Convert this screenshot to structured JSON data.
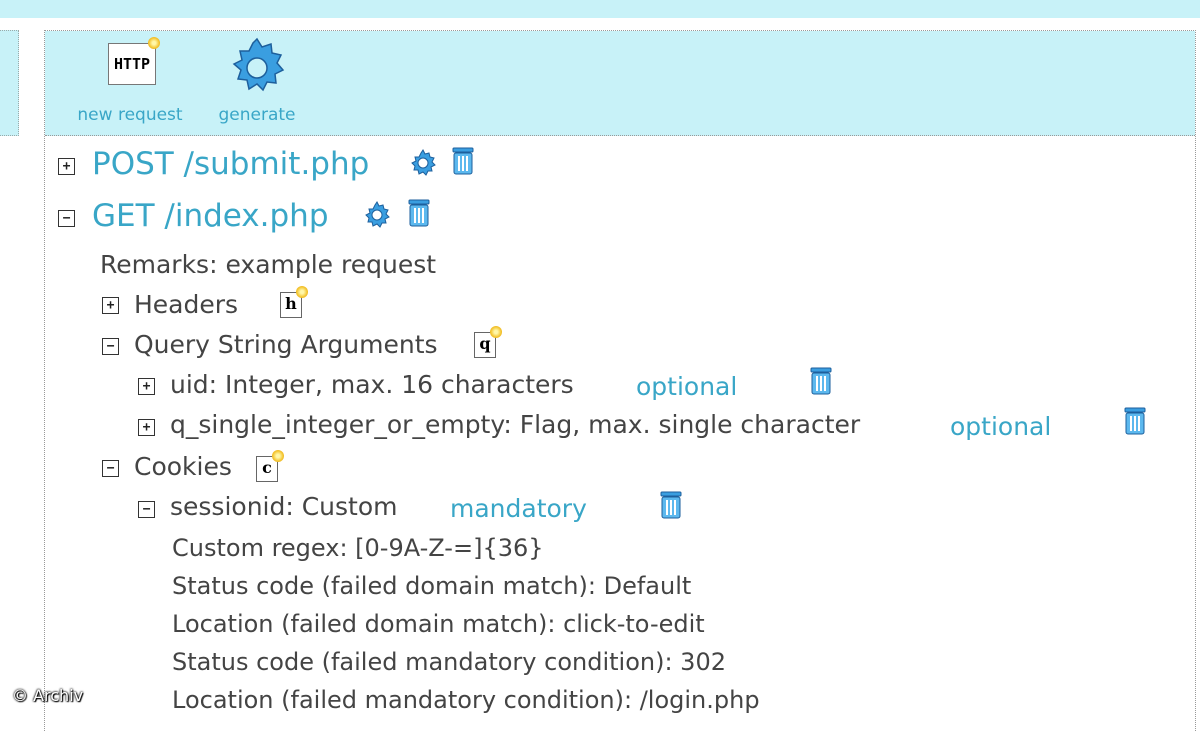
{
  "toolbar": {
    "new_request_label": "new request",
    "generate_label": "generate",
    "http_icon_text": "HTTP"
  },
  "requests": [
    {
      "title": "POST /submit.php",
      "expanded": false
    },
    {
      "title": "GET /index.php",
      "expanded": true
    }
  ],
  "remarks": "Remarks: example request",
  "sections": {
    "headers": {
      "label": "Headers",
      "icon_letter": "h"
    },
    "query": {
      "label": "Query String Arguments",
      "icon_letter": "q"
    },
    "cookies": {
      "label": "Cookies",
      "icon_letter": "c"
    }
  },
  "query_args": [
    {
      "text": "uid: Integer, max. 16 characters",
      "tag": "optional"
    },
    {
      "text": "q_single_integer_or_empty: Flag, max. single character",
      "tag": "optional"
    }
  ],
  "cookie": {
    "text": "sessionid: Custom",
    "tag": "mandatory",
    "details": [
      "Custom regex: [0-9A-Z-=]{36}",
      "Status code (failed domain match): Default",
      "Location (failed domain match): click-to-edit",
      "Status code (failed mandatory condition): 302",
      "Location (failed mandatory condition): /login.php"
    ]
  },
  "tree_symbols": {
    "collapsed": "+",
    "expanded": "−"
  },
  "watermark": "© Archiv",
  "colors": {
    "accent": "#39a6c7",
    "toolbar_bg": "#c8f2f8",
    "text": "#444444"
  }
}
